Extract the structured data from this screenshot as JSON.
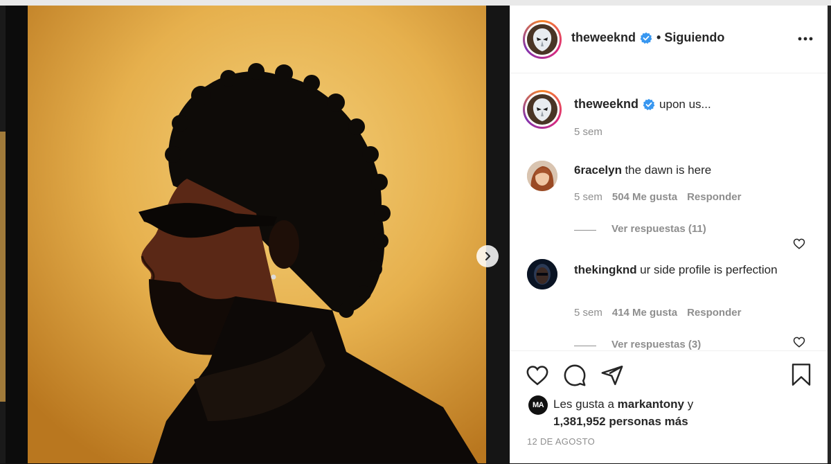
{
  "post": {
    "author": "theweeknd",
    "follow_status": "• Siguiendo",
    "caption": "upon us...",
    "caption_time": "5 sem",
    "date": "12 DE AGOSTO"
  },
  "comments": [
    {
      "user": "6racelyn",
      "text": "the dawn is here",
      "time": "5 sem",
      "likes": "504 Me gusta",
      "reply": "Responder",
      "view_replies": "Ver respuestas (11)"
    },
    {
      "user": "thekingknd",
      "text": "ur side profile is perfection",
      "time": "5 sem",
      "likes": "414 Me gusta",
      "reply": "Responder",
      "view_replies": "Ver respuestas (3)"
    }
  ],
  "likes": {
    "prefix": "Les gusta a",
    "user": "markantony",
    "joiner": "y",
    "count": "1,381,952 personas más",
    "avatar_initials": "MA"
  },
  "colors": {
    "verified": "#3897f0",
    "text": "#262626",
    "muted": "#8e8e8e"
  }
}
